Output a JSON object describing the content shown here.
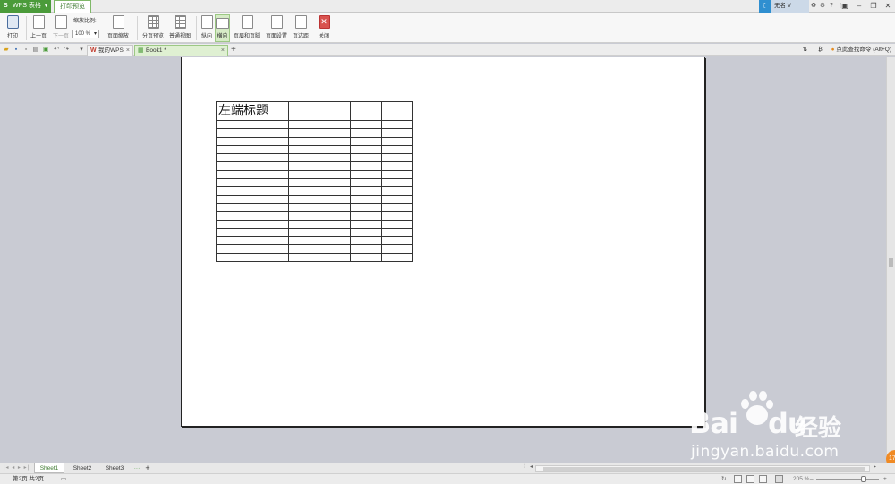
{
  "titlebar": {
    "app_name": "WPS 表格",
    "active_tab": "打印预览",
    "user_name": "无名 V"
  },
  "ribbon": {
    "print_label": "打印",
    "prev_page_label": "上一页",
    "next_page_label": "下一页",
    "zoom_ratio_label": "缩放比例:",
    "zoom_value": "100 %",
    "page_zoom_label": "页面缩放",
    "page_break_preview_label": "分页预览",
    "normal_view_label": "普通视图",
    "portrait_label": "纵向",
    "landscape_label": "横向",
    "header_footer_label": "页眉和页脚",
    "page_setup_label": "页面设置",
    "margins_label": "页边距",
    "close_label": "关闭"
  },
  "doc_tabs": {
    "my_wps": "我的WPS",
    "book1": "Book1 *",
    "command_search": "点此查找命令 (Alt+Q)"
  },
  "sheet": {
    "title_cell": "左端标题",
    "rows": 17,
    "cols": 5
  },
  "sheet_tabs": [
    "Sheet1",
    "Sheet2",
    "Sheet3"
  ],
  "sheet_tab_more": "···",
  "statusbar": {
    "page_info": "第2页 共2页",
    "zoom": "205 %"
  },
  "watermark": {
    "brand": "Bai",
    "brand2": "du",
    "cn": "经验",
    "url": "jingyan.baidu.com"
  }
}
